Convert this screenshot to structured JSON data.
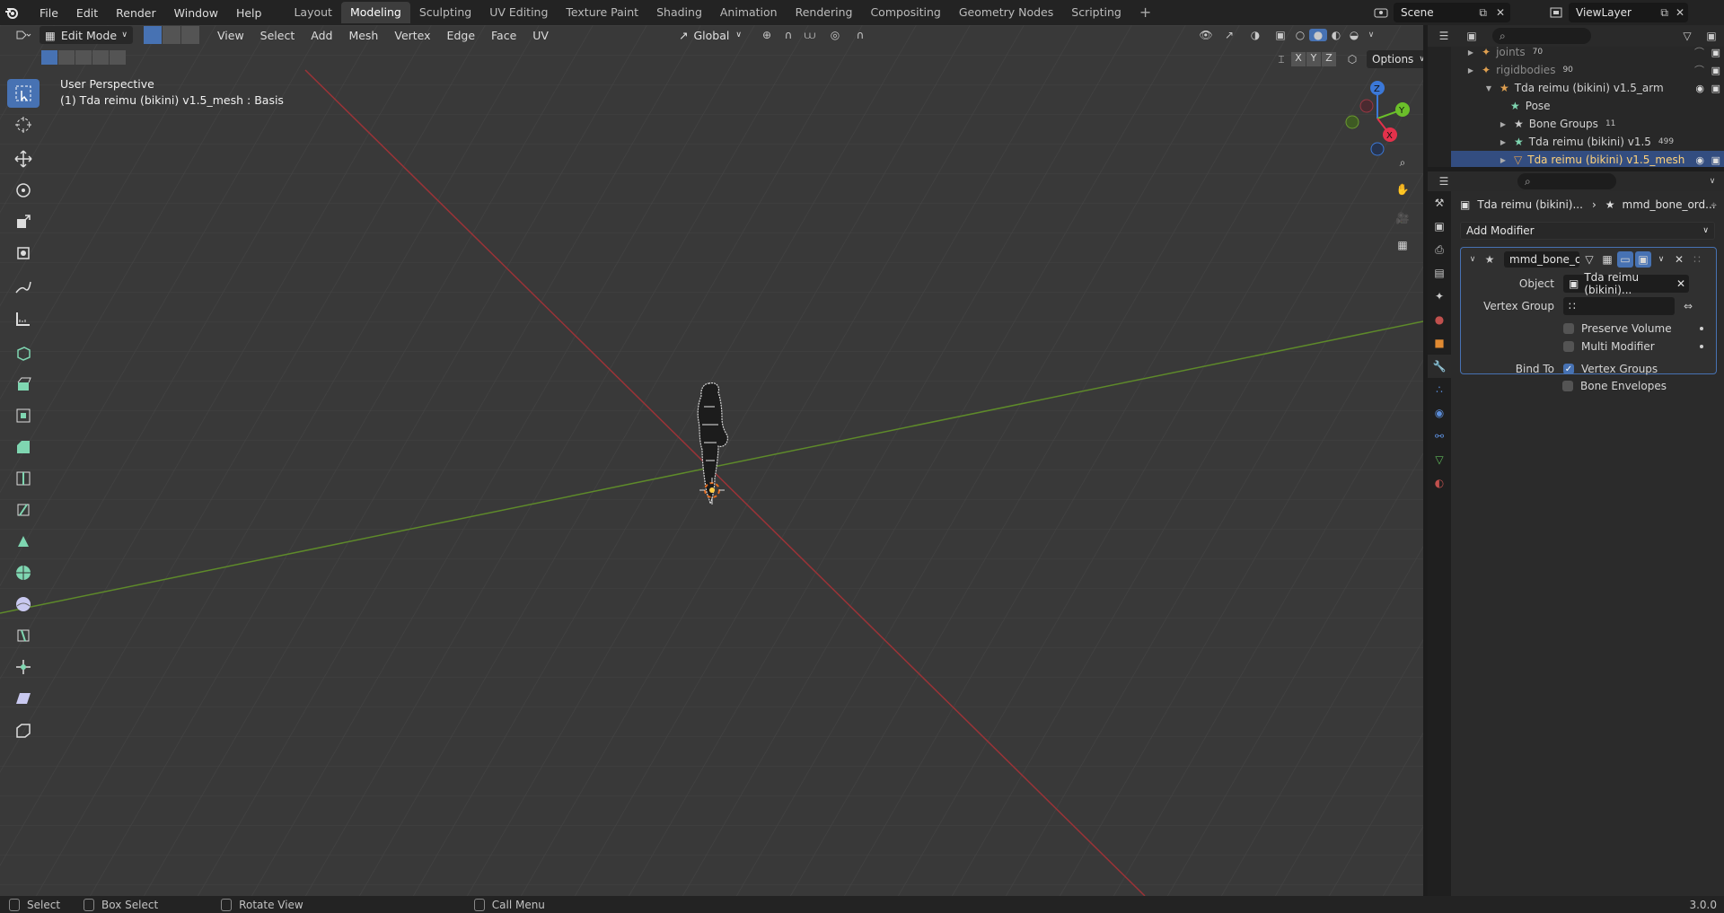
{
  "menu": [
    "File",
    "Edit",
    "Render",
    "Window",
    "Help"
  ],
  "workspace_tabs": [
    {
      "label": "Layout",
      "active": false
    },
    {
      "label": "Modeling",
      "active": true
    },
    {
      "label": "Sculpting",
      "active": false
    },
    {
      "label": "UV Editing",
      "active": false
    },
    {
      "label": "Texture Paint",
      "active": false
    },
    {
      "label": "Shading",
      "active": false
    },
    {
      "label": "Animation",
      "active": false
    },
    {
      "label": "Rendering",
      "active": false
    },
    {
      "label": "Compositing",
      "active": false
    },
    {
      "label": "Geometry Nodes",
      "active": false
    },
    {
      "label": "Scripting",
      "active": false
    }
  ],
  "scene": {
    "name": "Scene",
    "view_layer": "ViewLayer"
  },
  "viewport_header": {
    "mode": "Edit Mode",
    "menus": [
      "View",
      "Select",
      "Add",
      "Mesh",
      "Vertex",
      "Edge",
      "Face",
      "UV"
    ],
    "transform_orientation": "Global",
    "axes": [
      "X",
      "Y",
      "Z"
    ],
    "options_label": "Options"
  },
  "viewport_overlay": {
    "perspective": "User Perspective",
    "object_info": "(1) Tda reimu (bikini) v1.5_mesh : Basis"
  },
  "gizmo": {
    "z": "Z",
    "y": "Y",
    "x": "X"
  },
  "outliner": {
    "rows": [
      {
        "label": "joints",
        "count": "70",
        "indent": 1,
        "selected": false
      },
      {
        "label": "rigidbodies",
        "count": "90",
        "indent": 1,
        "selected": false
      },
      {
        "label": "Tda reimu (bikini) v1.5_arm",
        "count": "",
        "indent": 1,
        "selected": false
      },
      {
        "label": "Pose",
        "count": "",
        "indent": 2,
        "selected": false
      },
      {
        "label": "Bone Groups",
        "count": "11",
        "indent": 2,
        "selected": false
      },
      {
        "label": "Tda reimu (bikini) v1.5",
        "count": "499",
        "indent": 2,
        "selected": false
      },
      {
        "label": "Tda reimu (bikini) v1.5_mesh",
        "count": "",
        "indent": 2,
        "selected": true
      }
    ]
  },
  "properties": {
    "breadcrumb_object": "Tda reimu (bikini)...",
    "breadcrumb_modifier": "mmd_bone_ord...",
    "add_modifier_label": "Add Modifier",
    "modifier": {
      "name": "mmd_bone_o...",
      "object_label": "Object",
      "object_value": "Tda reimu (bikini)...",
      "vertex_group_label": "Vertex Group",
      "vertex_group_value": "",
      "preserve_volume_label": "Preserve Volume",
      "preserve_volume": false,
      "multi_modifier_label": "Multi Modifier",
      "multi_modifier": false,
      "bind_to_label": "Bind To",
      "vertex_groups_label": "Vertex Groups",
      "vertex_groups": true,
      "bone_envelopes_label": "Bone Envelopes",
      "bone_envelopes": false
    }
  },
  "status_bar": {
    "select": "Select",
    "box_select": "Box Select",
    "rotate_view": "Rotate View",
    "call_menu": "Call Menu",
    "version": "3.0.0"
  },
  "colors": {
    "accent": "#4772b3",
    "x_axis": "#b3393c",
    "y_axis": "#6b9a2f",
    "viewport_bg": "#393939"
  }
}
